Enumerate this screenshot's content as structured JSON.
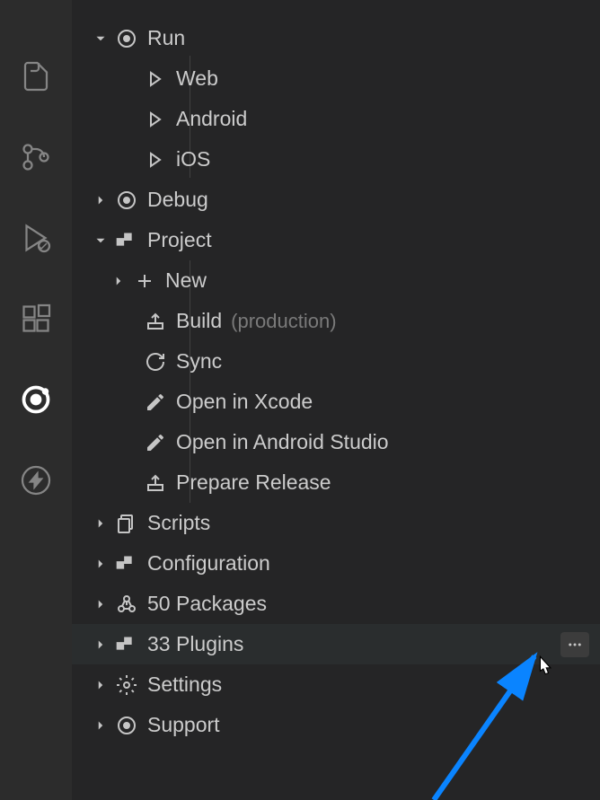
{
  "activityBar": {
    "icons": [
      "files",
      "git",
      "debug",
      "extensions",
      "ionic",
      "thunder"
    ]
  },
  "tree": {
    "run": {
      "label": "Run",
      "children": {
        "web": "Web",
        "android": "Android",
        "ios": "iOS"
      }
    },
    "debug": {
      "label": "Debug"
    },
    "project": {
      "label": "Project",
      "children": {
        "new": "New",
        "build": "Build",
        "build_sub": "(production)",
        "sync": "Sync",
        "openXcode": "Open in Xcode",
        "openAndroid": "Open in Android Studio",
        "prepare": "Prepare Release"
      }
    },
    "scripts": {
      "label": "Scripts"
    },
    "configuration": {
      "label": "Configuration"
    },
    "packages": {
      "label": "50 Packages"
    },
    "plugins": {
      "label": "33 Plugins"
    },
    "settings": {
      "label": "Settings"
    },
    "support": {
      "label": "Support"
    }
  }
}
